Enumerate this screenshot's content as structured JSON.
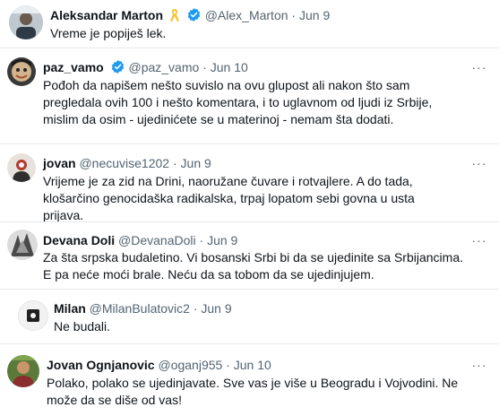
{
  "tweets": [
    {
      "name": "Aleksandar Marton",
      "ribbon": true,
      "verified": true,
      "handle": "@Alex_Marton",
      "date": "Jun 9",
      "text": "Vreme je popiješ lek."
    },
    {
      "name": "paz_vamo",
      "verified": true,
      "handle": "@paz_vamo",
      "date": "Jun 10",
      "text": "Pođoh da napišem nešto suvislo na ovu glupost ali nakon što sam pregledala ovih 100 i nešto komentara, i to uglavnom od ljudi iz Srbije, mislim da osim - ujedinićete se u materinoj - nemam šta dodati."
    },
    {
      "name": "jovan",
      "verified": false,
      "handle": "@necuvise1202",
      "date": "Jun 9",
      "text": "Vrijeme je za zid na Drini, naoružane čuvare i rotvajlere. A do tada, klošarčino genocidaška radikalska, trpaj lopatom sebi govna u usta prijava."
    },
    {
      "name": "Devana Doli",
      "verified": false,
      "handle": "@DevanaDoli",
      "date": "Jun 9",
      "text": "Za šta srpska budaletino. Vi bosanski Srbi bi da se ujedinite sa Srbijancima. E pa neće moći brale. Neću da sa tobom da se ujedinjujem."
    },
    {
      "name": "Milan",
      "verified": false,
      "handle": "@MilanBulatovic2",
      "date": "Jun 9",
      "text": "Ne budali."
    },
    {
      "name": "Jovan Ognjanovic",
      "verified": false,
      "handle": "@oganj955",
      "date": "Jun 10",
      "text": "Polako, polako se ujedinjavate. Sve vas je više u Beogradu i Vojvodini. Ne može da se diše od vas!"
    }
  ],
  "more_label": "···",
  "colors": {
    "verified": "#1d9bf0",
    "ribbon": "#f4c430",
    "meta": "#536471",
    "divider": "#e6e9ec"
  },
  "icons": [
    "verified-badge-icon",
    "yellow-ribbon-icon",
    "more-options-icon"
  ]
}
